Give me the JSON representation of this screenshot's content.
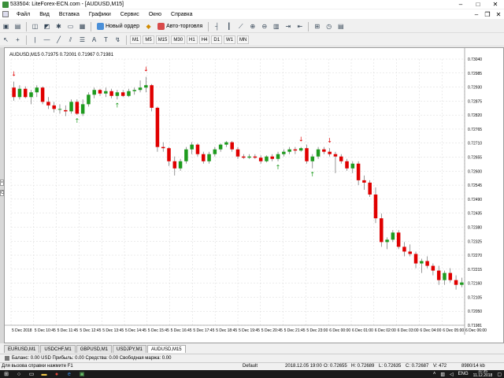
{
  "window": {
    "title": "533504: LiteForex-ECN.com - [AUDUSD,M15]"
  },
  "menu": [
    "Файл",
    "Вид",
    "Вставка",
    "Графики",
    "Сервис",
    "Окно",
    "Справка"
  ],
  "toolbar": {
    "new_order": "Новый ордер",
    "auto_trading": "Авто-торговля"
  },
  "timeframes": [
    "M1",
    "M5",
    "M15",
    "M30",
    "H1",
    "H4",
    "D1",
    "W1",
    "MN"
  ],
  "chart": {
    "header": "AUDUSD,M15  0.71975 0.72001 0.71967 0.71981",
    "price_axis": [
      "0.73040",
      "0.72985",
      "0.72930",
      "0.72875",
      "0.72820",
      "0.72765",
      "0.72710",
      "0.72655",
      "0.72600",
      "0.72545",
      "0.72490",
      "0.72435",
      "0.72380",
      "0.72325",
      "0.72270",
      "0.72215",
      "0.72160",
      "0.72105",
      "0.72050",
      "0.71981"
    ],
    "time_axis": [
      "5 Dec 2018",
      "5 Dec 10:45",
      "5 Dec 11:45",
      "5 Dec 12:45",
      "5 Dec 13:45",
      "5 Dec 14:45",
      "5 Dec 15:45",
      "5 Dec 16:45",
      "5 Dec 17:45",
      "5 Dec 18:45",
      "5 Dec 19:45",
      "5 Dec 20:45",
      "5 Dec 21:45",
      "5 Dec 23:00",
      "6 Dec 00:00",
      "6 Dec 01:00",
      "6 Dec 02:00",
      "6 Dec 03:00",
      "6 Dec 04:00",
      "6 Dec 05:00",
      "6 Dec 06:00"
    ],
    "colors": {
      "bull": "#1e9b1e",
      "bear": "#e00000",
      "wick": "#555555",
      "grid": "#d8d8d8"
    }
  },
  "chart_data": {
    "type": "candlestick",
    "symbol": "AUDUSD",
    "timeframe": "M15",
    "ylim": [
      0.7195,
      0.7307
    ],
    "candles": [
      [
        0.7295,
        0.72975,
        0.72895,
        0.7291
      ],
      [
        0.7291,
        0.7296,
        0.729,
        0.72945
      ],
      [
        0.72945,
        0.72955,
        0.72905,
        0.7291
      ],
      [
        0.7291,
        0.7294,
        0.7288,
        0.7293
      ],
      [
        0.7293,
        0.7296,
        0.7291,
        0.7295
      ],
      [
        0.7295,
        0.72955,
        0.7288,
        0.7289
      ],
      [
        0.7289,
        0.7291,
        0.7286,
        0.72875
      ],
      [
        0.72875,
        0.7289,
        0.72845,
        0.7286
      ],
      [
        0.7286,
        0.7288,
        0.7284,
        0.7286
      ],
      [
        0.72855,
        0.72875,
        0.7283,
        0.7285
      ],
      [
        0.7285,
        0.729,
        0.7284,
        0.7289
      ],
      [
        0.7289,
        0.729,
        0.72835,
        0.7284
      ],
      [
        0.7284,
        0.729,
        0.7283,
        0.7288
      ],
      [
        0.7288,
        0.7293,
        0.7287,
        0.7292
      ],
      [
        0.7292,
        0.7295,
        0.72905,
        0.7294
      ],
      [
        0.7294,
        0.72945,
        0.72915,
        0.72925
      ],
      [
        0.72925,
        0.7295,
        0.7291,
        0.72935
      ],
      [
        0.72935,
        0.72945,
        0.72905,
        0.72915
      ],
      [
        0.72915,
        0.7294,
        0.729,
        0.7293
      ],
      [
        0.7293,
        0.7294,
        0.7291,
        0.72915
      ],
      [
        0.72915,
        0.72945,
        0.7291,
        0.72935
      ],
      [
        0.72935,
        0.7295,
        0.7292,
        0.7294
      ],
      [
        0.7294,
        0.7298,
        0.7293,
        0.7295
      ],
      [
        0.7295,
        0.72995,
        0.7293,
        0.7296
      ],
      [
        0.7296,
        0.72965,
        0.7285,
        0.72865
      ],
      [
        0.72865,
        0.7287,
        0.7268,
        0.727
      ],
      [
        0.727,
        0.7272,
        0.7268,
        0.72695
      ],
      [
        0.72695,
        0.727,
        0.7262,
        0.7264
      ],
      [
        0.7264,
        0.7266,
        0.7258,
        0.7261
      ],
      [
        0.7261,
        0.7265,
        0.726,
        0.7264
      ],
      [
        0.7264,
        0.727,
        0.7263,
        0.7269
      ],
      [
        0.7269,
        0.7272,
        0.7267,
        0.7271
      ],
      [
        0.7271,
        0.72715,
        0.7266,
        0.7267
      ],
      [
        0.7267,
        0.7268,
        0.7263,
        0.7264
      ],
      [
        0.7264,
        0.7268,
        0.7263,
        0.7267
      ],
      [
        0.7267,
        0.727,
        0.7266,
        0.7269
      ],
      [
        0.7269,
        0.72715,
        0.7268,
        0.7271
      ],
      [
        0.7271,
        0.72725,
        0.727,
        0.7272
      ],
      [
        0.7272,
        0.72725,
        0.7268,
        0.7269
      ],
      [
        0.7269,
        0.727,
        0.7265,
        0.7266
      ],
      [
        0.7266,
        0.7267,
        0.7265,
        0.72655
      ],
      [
        0.72655,
        0.7267,
        0.7265,
        0.7266
      ],
      [
        0.7266,
        0.7267,
        0.7265,
        0.72655
      ],
      [
        0.72655,
        0.72665,
        0.7263,
        0.7264
      ],
      [
        0.7264,
        0.72665,
        0.72635,
        0.7266
      ],
      [
        0.7266,
        0.7267,
        0.7264,
        0.7265
      ],
      [
        0.7265,
        0.7268,
        0.7264,
        0.7267
      ],
      [
        0.7267,
        0.7269,
        0.7266,
        0.7268
      ],
      [
        0.7268,
        0.727,
        0.7267,
        0.7269
      ],
      [
        0.7269,
        0.727,
        0.7267,
        0.72685
      ],
      [
        0.72685,
        0.727,
        0.7268,
        0.72695
      ],
      [
        0.72695,
        0.7271,
        0.7263,
        0.7264
      ],
      [
        0.7264,
        0.7267,
        0.7261,
        0.7266
      ],
      [
        0.7266,
        0.727,
        0.7265,
        0.7269
      ],
      [
        0.7269,
        0.727,
        0.7267,
        0.7268
      ],
      [
        0.7268,
        0.72695,
        0.7266,
        0.7267
      ],
      [
        0.7267,
        0.7268,
        0.7259,
        0.7266
      ],
      [
        0.7266,
        0.7267,
        0.7263,
        0.7264
      ],
      [
        0.7264,
        0.7265,
        0.726,
        0.7261
      ],
      [
        0.7261,
        0.7264,
        0.7259,
        0.7263
      ],
      [
        0.7263,
        0.7264,
        0.7254,
        0.7256
      ],
      [
        0.7256,
        0.7258,
        0.7252,
        0.7255
      ],
      [
        0.7255,
        0.7256,
        0.7249,
        0.725
      ],
      [
        0.725,
        0.7253,
        0.7238,
        0.724
      ],
      [
        0.724,
        0.7242,
        0.7228,
        0.723
      ],
      [
        0.723,
        0.7232,
        0.7227,
        0.7231
      ],
      [
        0.7231,
        0.7235,
        0.723,
        0.7234
      ],
      [
        0.7234,
        0.7235,
        0.7227,
        0.7228
      ],
      [
        0.7228,
        0.723,
        0.7224,
        0.7226
      ],
      [
        0.7226,
        0.7229,
        0.7224,
        0.7225
      ],
      [
        0.7225,
        0.7226,
        0.7219,
        0.7221
      ],
      [
        0.7221,
        0.7223,
        0.7217,
        0.7222
      ],
      [
        0.7222,
        0.7224,
        0.7219,
        0.722
      ],
      [
        0.722,
        0.7221,
        0.7216,
        0.7218
      ],
      [
        0.7218,
        0.722,
        0.7212,
        0.7214
      ],
      [
        0.7214,
        0.7218,
        0.7212,
        0.7217
      ],
      [
        0.7217,
        0.7219,
        0.7213,
        0.7214
      ],
      [
        0.7214,
        0.7216,
        0.721,
        0.7212
      ],
      [
        0.7212,
        0.7215,
        0.7211,
        0.7213
      ]
    ],
    "arrows": [
      {
        "index": 0,
        "dir": "down"
      },
      {
        "index": 11,
        "dir": "up"
      },
      {
        "index": 18,
        "dir": "up"
      },
      {
        "index": 23,
        "dir": "down"
      },
      {
        "index": 46,
        "dir": "up"
      },
      {
        "index": 50,
        "dir": "down"
      },
      {
        "index": 52,
        "dir": "up"
      },
      {
        "index": 55,
        "dir": "down"
      }
    ]
  },
  "tabs": [
    "EURUSD,M1",
    "USDCHF,M1",
    "GBPUSD,M1",
    "USDJPY,M1",
    "AUDUSD,M15"
  ],
  "active_tab": "AUDUSD,M15",
  "terminal": {
    "balance": "Баланс: 0.00 USD  Прибыль: 0.00  Средства: 0.00  Свободная маржа: 0.00"
  },
  "status": {
    "help": "Для вызова справки нажмите F1",
    "profile": "Default",
    "datetime": "2018.12.05 19:00",
    "open": "O: 0.72655",
    "high": "H: 0.72689",
    "low": "L: 0.72635",
    "close": "C: 0.72687",
    "volume": "V: 472",
    "traffic": "8980/14 kb"
  },
  "taskbar": {
    "lang": "ENG",
    "time": "11:35",
    "date": "11.12.2018"
  }
}
